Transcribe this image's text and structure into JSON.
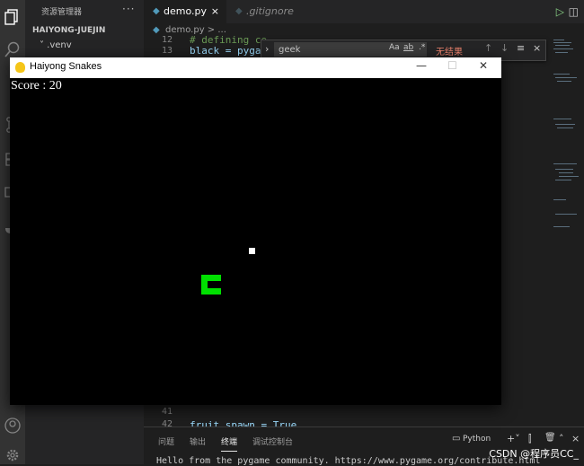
{
  "sidebar": {
    "header": "资源管理器",
    "more": "···",
    "project": "HAIYONG-JUEJIN",
    "venv": "˅ .venv"
  },
  "tabs": [
    {
      "label": "demo.py",
      "close": "×"
    },
    {
      "label": ".gitignore"
    }
  ],
  "breadcrumb": "demo.py > ...",
  "editor": {
    "lines": [
      {
        "num": "12",
        "code": "# defining co"
      },
      {
        "num": "13",
        "code": "black = pygame"
      },
      {
        "num": "41",
        "code": ""
      },
      {
        "num": "42",
        "code": "fruit_spawn = True"
      }
    ]
  },
  "find": {
    "query": "geek",
    "case": "Aa",
    "word": "ab",
    "regex": ".*",
    "no_results": "无结果",
    "prev": "↑",
    "next": "↓",
    "selection": "≡",
    "close": "×"
  },
  "panel": {
    "tabs": [
      "问题",
      "输出",
      "终端",
      "调试控制台"
    ],
    "python": "Python",
    "plus": "+˅",
    "split": "⫿",
    "trash": "🗑",
    "up": "˄",
    "close": "×",
    "terminal_text": "Hello from the pygame community. https://www.pygame.org/contribute.html"
  },
  "game": {
    "title": "Haiyong Snakes",
    "minimize": "—",
    "maximize": "☐",
    "close": "✕",
    "score_text": "Score : 20",
    "colors": {
      "snake": "#00e000",
      "fruit": "#ffffff",
      "background": "#000000"
    }
  },
  "watermark": "CSDN @程序员CC_"
}
